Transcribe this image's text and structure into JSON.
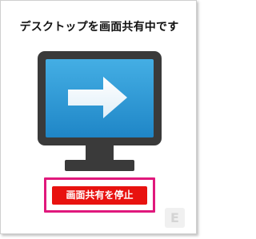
{
  "dialog": {
    "title": "デスクトップを画面共有中です",
    "stop_button_label": "画面共有を停止",
    "badge_label": "E"
  },
  "icons": {
    "monitor": "monitor-share-icon",
    "arrow": "arrow-right-icon"
  },
  "colors": {
    "button_red": "#e8120f",
    "highlight_pink": "#e0187c",
    "monitor_frame": "#3a3a3a",
    "screen_blue": "#2f9bd6",
    "badge_bg": "#f0f0f0"
  }
}
